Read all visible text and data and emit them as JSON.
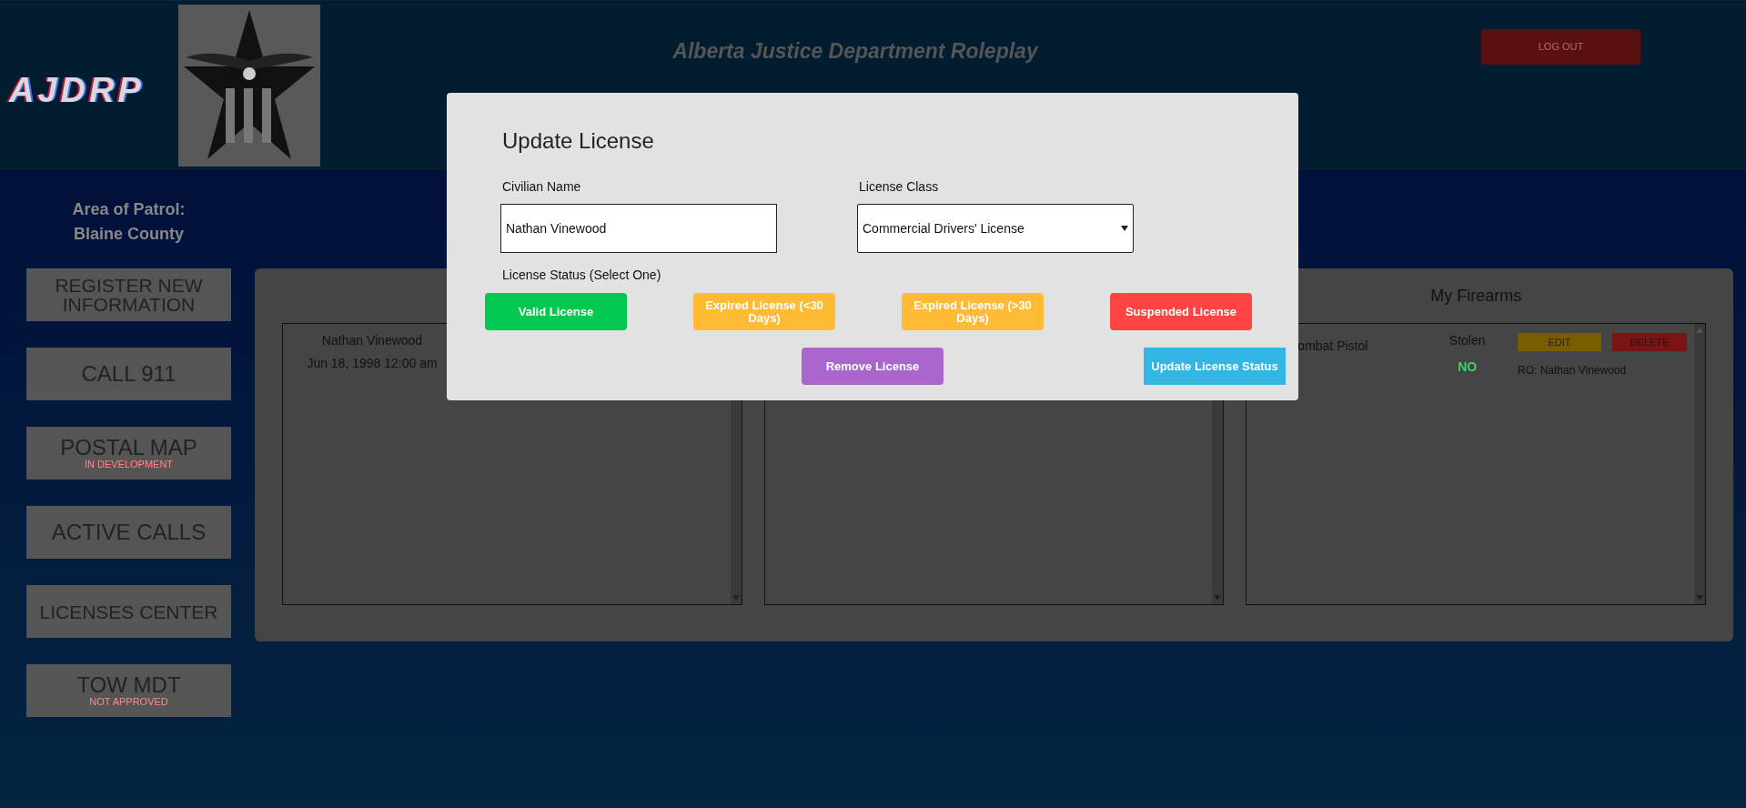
{
  "header": {
    "logo_text": "AJDRP",
    "title": "Alberta Justice Department Roleplay",
    "logout": "LOG OUT"
  },
  "sidebar": {
    "area_label": "Area of Patrol:",
    "area_value": "Blaine County",
    "buttons": [
      {
        "label": "REGISTER NEW INFORMATION"
      },
      {
        "label": "CALL 911"
      },
      {
        "label": "POSTAL MAP",
        "note": "IN DEVELOPMENT"
      },
      {
        "label": "ACTIVE CALLS"
      },
      {
        "label": "LICENSES CENTER"
      },
      {
        "label": "TOW MDT",
        "note": "NOT APPROVED"
      }
    ]
  },
  "panels": [
    {
      "kind": "list",
      "lines": [
        "Nathan Vinewood",
        "Jun 18, 1998 12:00 am"
      ]
    },
    {
      "kind": "list"
    },
    {
      "kind": "list",
      "title": "My Firearms",
      "firearm": {
        "name": "ombat Pistol",
        "stolen_label": "Stolen",
        "stolen_value": "NO",
        "edit": "EDIT",
        "delete": "DELETE",
        "owner": "RO: Nathan Vinewood"
      }
    }
  ],
  "modal": {
    "title": "Update License",
    "fields": [
      {
        "kind": "text",
        "label": "Civilian Name",
        "value": "Nathan Vinewood"
      },
      {
        "kind": "select",
        "label": "License Class",
        "value": "Commercial Drivers' License"
      }
    ],
    "status_label": "License Status (Select One)",
    "status_options": [
      {
        "label": "Valid License",
        "color": "#00c851"
      },
      {
        "label": "Expired License (<30 Days)",
        "color": "#ffbb33"
      },
      {
        "label": "Expired License (>30 Days)",
        "color": "#ffbb33"
      },
      {
        "label": "Suspended License",
        "color": "#ff4444"
      }
    ],
    "actions": [
      {
        "label": "Remove License",
        "color": "#aa66cc"
      },
      {
        "label": "Update License Status",
        "color": "#33b5e5"
      }
    ]
  }
}
